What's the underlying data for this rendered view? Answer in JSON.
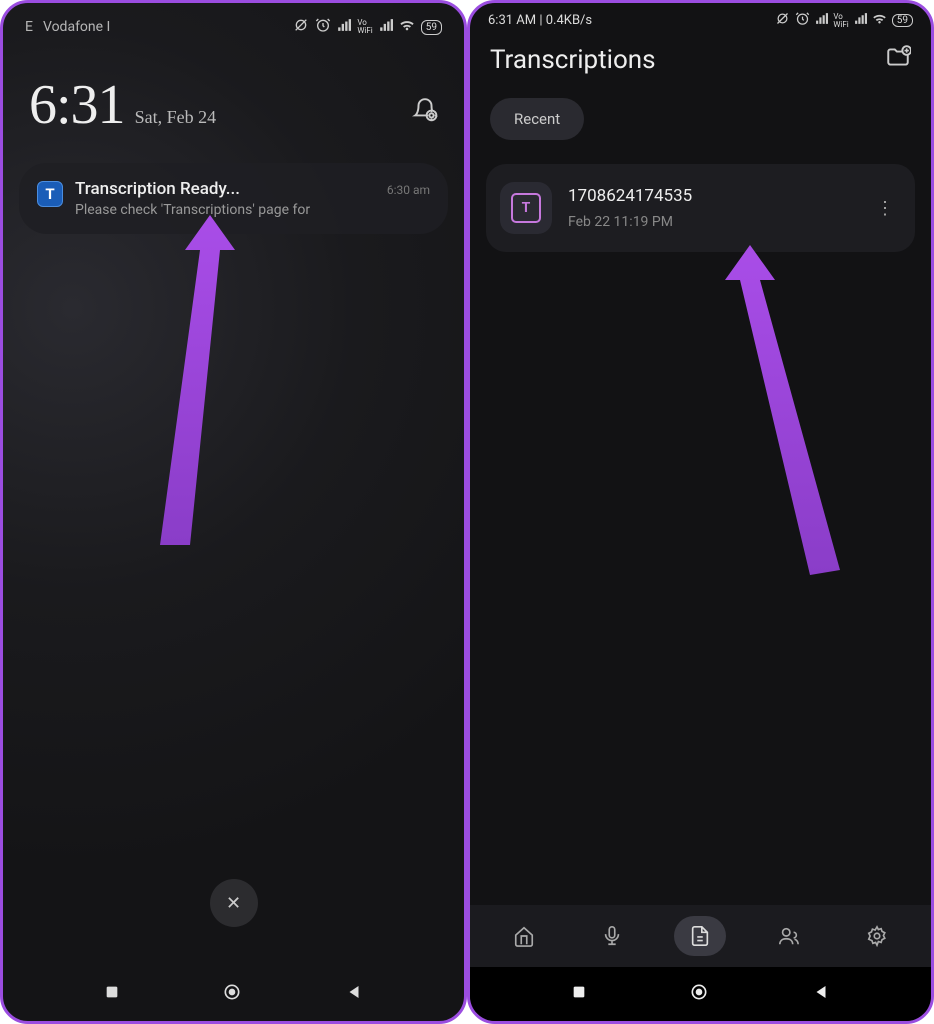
{
  "left": {
    "status": {
      "carrier_e": "E",
      "carrier": "Vodafone I",
      "battery": "59"
    },
    "clock": {
      "time": "6:31",
      "date": "Sat, Feb 24"
    },
    "notification": {
      "app_letter": "T",
      "title": "Transcription Ready...",
      "text": "Please check 'Transcriptions' page for",
      "time": "6:30 am"
    }
  },
  "right": {
    "status": {
      "time_data": "6:31 AM | 0.4KB/s",
      "battery": "59"
    },
    "header": {
      "title": "Transcriptions"
    },
    "filter": "Recent",
    "item": {
      "icon_letter": "T",
      "title": "1708624174535",
      "date": "Feb 22 11:19 PM"
    }
  }
}
